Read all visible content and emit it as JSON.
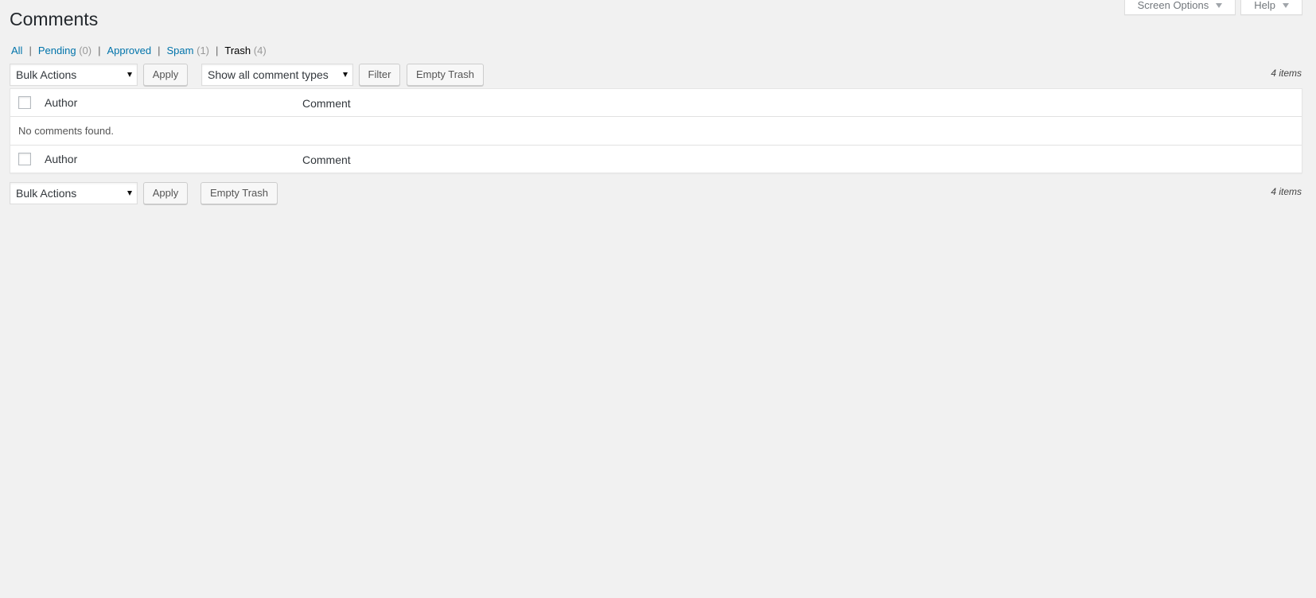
{
  "screen_meta": {
    "screen_options_label": "Screen Options",
    "help_label": "Help"
  },
  "page": {
    "title": "Comments"
  },
  "filters": [
    {
      "label": "All",
      "count": ""
    },
    {
      "label": "Pending",
      "count": "(0)"
    },
    {
      "label": "Approved",
      "count": ""
    },
    {
      "label": "Spam",
      "count": "(1)"
    },
    {
      "label": "Trash",
      "count": "(4)"
    }
  ],
  "separator": "|",
  "tablenav_top": {
    "bulk_actions": "Bulk Actions",
    "apply": "Apply",
    "comment_type": "Show all comment types",
    "filter": "Filter",
    "empty_trash": "Empty Trash",
    "items": "4 items"
  },
  "table": {
    "col_author": "Author",
    "col_comment": "Comment",
    "empty_message": "No comments found."
  },
  "tablenav_bottom": {
    "bulk_actions": "Bulk Actions",
    "apply": "Apply",
    "empty_trash": "Empty Trash",
    "items": "4 items"
  },
  "colors": {
    "link": "#0073aa",
    "background": "#f1f1f1"
  }
}
